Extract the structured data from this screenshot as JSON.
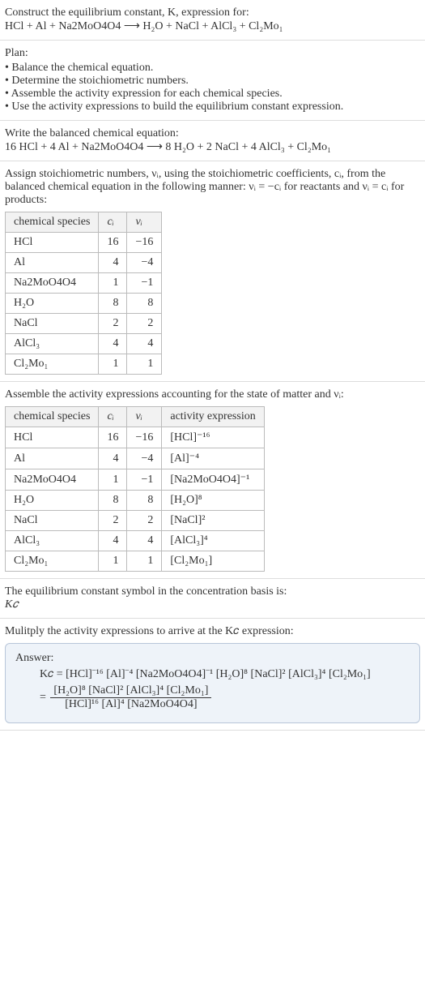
{
  "title": "Construct the equilibrium constant, K, expression for:",
  "unbalanced_equation": "HCl + Al + Na2MoO4O4 ⟶ H₂O + NaCl + AlCl₃ + Cl₂Mo₁",
  "plan_heading": "Plan:",
  "plan_items": [
    "Balance the chemical equation.",
    "Determine the stoichiometric numbers.",
    "Assemble the activity expression for each chemical species.",
    "Use the activity expressions to build the equilibrium constant expression."
  ],
  "balanced_heading": "Write the balanced chemical equation:",
  "balanced_equation": "16 HCl + 4 Al + Na2MoO4O4 ⟶ 8 H₂O + 2 NaCl + 4 AlCl₃ + Cl₂Mo₁",
  "assign_heading": "Assign stoichiometric numbers, νᵢ, using the stoichiometric coefficients, cᵢ, from the balanced chemical equation in the following manner: νᵢ = −cᵢ for reactants and νᵢ = cᵢ for products:",
  "table1_headers": [
    "chemical species",
    "cᵢ",
    "νᵢ"
  ],
  "table1_rows": [
    {
      "species": "HCl",
      "c": "16",
      "v": "−16"
    },
    {
      "species": "Al",
      "c": "4",
      "v": "−4"
    },
    {
      "species": "Na2MoO4O4",
      "c": "1",
      "v": "−1"
    },
    {
      "species": "H₂O",
      "c": "8",
      "v": "8"
    },
    {
      "species": "NaCl",
      "c": "2",
      "v": "2"
    },
    {
      "species": "AlCl₃",
      "c": "4",
      "v": "4"
    },
    {
      "species": "Cl₂Mo₁",
      "c": "1",
      "v": "1"
    }
  ],
  "assemble_heading": "Assemble the activity expressions accounting for the state of matter and νᵢ:",
  "table2_headers": [
    "chemical species",
    "cᵢ",
    "νᵢ",
    "activity expression"
  ],
  "table2_rows": [
    {
      "species": "HCl",
      "c": "16",
      "v": "−16",
      "act": "[HCl]⁻¹⁶"
    },
    {
      "species": "Al",
      "c": "4",
      "v": "−4",
      "act": "[Al]⁻⁴"
    },
    {
      "species": "Na2MoO4O4",
      "c": "1",
      "v": "−1",
      "act": "[Na2MoO4O4]⁻¹"
    },
    {
      "species": "H₂O",
      "c": "8",
      "v": "8",
      "act": "[H₂O]⁸"
    },
    {
      "species": "NaCl",
      "c": "2",
      "v": "2",
      "act": "[NaCl]²"
    },
    {
      "species": "AlCl₃",
      "c": "4",
      "v": "4",
      "act": "[AlCl₃]⁴"
    },
    {
      "species": "Cl₂Mo₁",
      "c": "1",
      "v": "1",
      "act": "[Cl₂Mo₁]"
    }
  ],
  "basis_heading": "The equilibrium constant symbol in the concentration basis is:",
  "basis_symbol": "K𝑐",
  "multiply_heading": "Mulitply the activity expressions to arrive at the K𝑐 expression:",
  "answer_label": "Answer:",
  "kc_product": "K𝑐 = [HCl]⁻¹⁶ [Al]⁻⁴ [Na2MoO4O4]⁻¹ [H₂O]⁸ [NaCl]² [AlCl₃]⁴ [Cl₂Mo₁]",
  "kc_equals": "= ",
  "kc_numerator": "[H₂O]⁸ [NaCl]² [AlCl₃]⁴ [Cl₂Mo₁]",
  "kc_denominator": "[HCl]¹⁶ [Al]⁴ [Na2MoO4O4]",
  "chart_data": {
    "type": "table",
    "tables": [
      {
        "title": "Stoichiometric numbers",
        "columns": [
          "chemical species",
          "c_i",
          "ν_i"
        ],
        "rows": [
          [
            "HCl",
            16,
            -16
          ],
          [
            "Al",
            4,
            -4
          ],
          [
            "Na2MoO4O4",
            1,
            -1
          ],
          [
            "H2O",
            8,
            8
          ],
          [
            "NaCl",
            2,
            2
          ],
          [
            "AlCl3",
            4,
            4
          ],
          [
            "Cl2Mo1",
            1,
            1
          ]
        ]
      },
      {
        "title": "Activity expressions",
        "columns": [
          "chemical species",
          "c_i",
          "ν_i",
          "activity expression"
        ],
        "rows": [
          [
            "HCl",
            16,
            -16,
            "[HCl]^-16"
          ],
          [
            "Al",
            4,
            -4,
            "[Al]^-4"
          ],
          [
            "Na2MoO4O4",
            1,
            -1,
            "[Na2MoO4O4]^-1"
          ],
          [
            "H2O",
            8,
            8,
            "[H2O]^8"
          ],
          [
            "NaCl",
            2,
            2,
            "[NaCl]^2"
          ],
          [
            "AlCl3",
            4,
            4,
            "[AlCl3]^4"
          ],
          [
            "Cl2Mo1",
            1,
            1,
            "[Cl2Mo1]"
          ]
        ]
      }
    ]
  }
}
